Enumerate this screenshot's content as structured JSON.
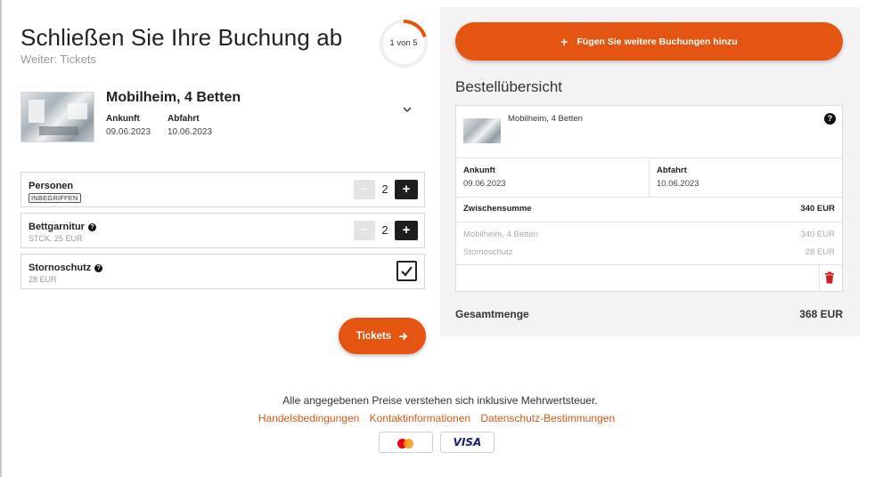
{
  "header": {
    "title": "Schließen Sie Ihre Buchung ab",
    "subtitle": "Weiter: Tickets",
    "progress_text": "1 von 5",
    "progress_fraction": 0.2
  },
  "product": {
    "title": "Mobilheim, 4 Betten",
    "arrival_label": "Ankunft",
    "arrival_date": "09.06.2023",
    "departure_label": "Abfahrt",
    "departure_date": "10.06.2023"
  },
  "options": [
    {
      "label": "Personen",
      "badge": "INBEGRIFFEN",
      "quantity": "2"
    },
    {
      "label": "Bettgarnitur",
      "sub": "STCK. 25 EUR",
      "quantity": "2"
    },
    {
      "label": "Stornoschutz",
      "sub": "28 EUR",
      "checked": true
    }
  ],
  "tickets_button": "Tickets",
  "summary": {
    "add_button": "Fügen Sie weitere Buchungen hinzu",
    "title": "Bestellübersicht",
    "item_title": "Mobilheim, 4 Betten",
    "arrival_label": "Ankunft",
    "arrival_date": "09.06.2023",
    "departure_label": "Abfahrt",
    "departure_date": "10.06.2023",
    "subtotal_label": "Zwischensumme",
    "subtotal_value": "340 EUR",
    "lines": [
      {
        "label": "Mobilheim, 4 Betten",
        "value": "340 EUR"
      },
      {
        "label": "Stornoschutz",
        "value": "28 EUR"
      }
    ],
    "total_label": "Gesamtmenge",
    "total_value": "368 EUR"
  },
  "footer": {
    "note": "Alle angegebenen Preise verstehen sich inklusive Mehrwertsteuer.",
    "links": [
      "Handelsbedingungen",
      "Kontaktinformationen",
      "Datenschutz-Bestimmungen"
    ],
    "visa": "VISA"
  },
  "colors": {
    "accent": "#e35511",
    "link": "#d35a1e",
    "panel_bg": "#f4f3f3",
    "trash": "#cc1f1f"
  }
}
